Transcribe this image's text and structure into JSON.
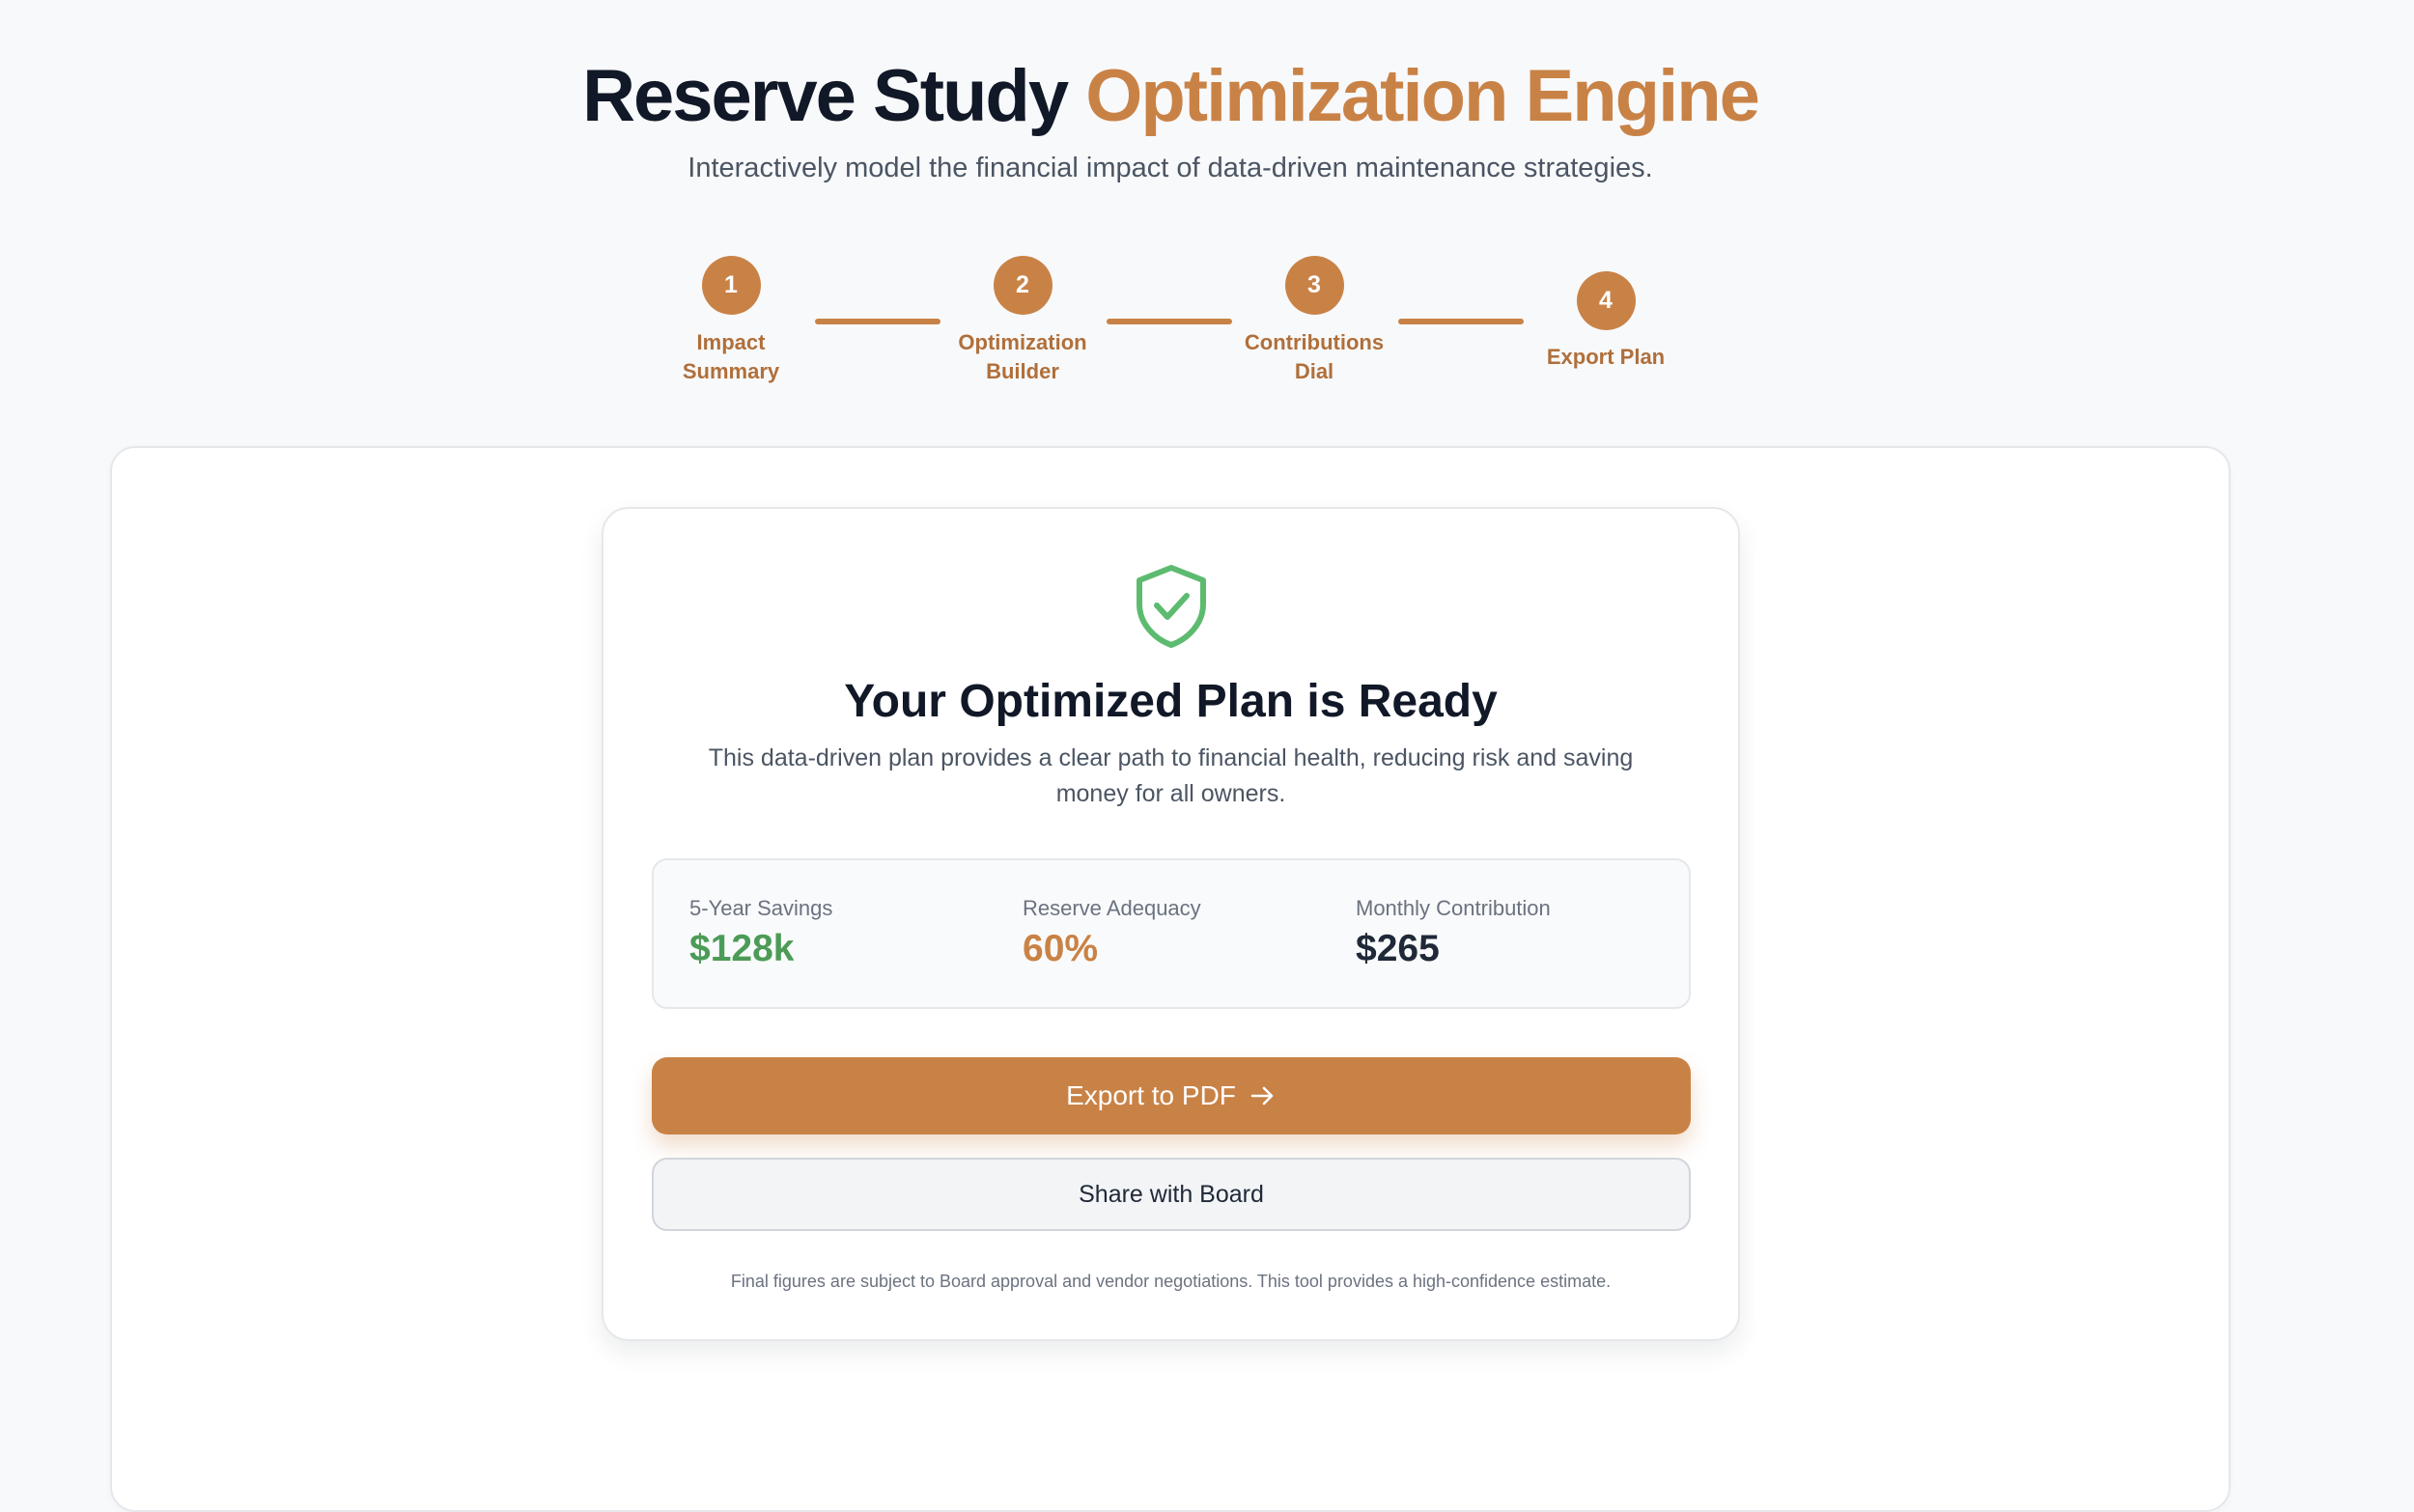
{
  "header": {
    "title_primary": "Reserve Study",
    "title_accent": "Optimization Engine",
    "subtitle": "Interactively model the financial impact of data-driven maintenance strategies."
  },
  "stepper": {
    "steps": [
      {
        "number": "1",
        "label": "Impact Summary"
      },
      {
        "number": "2",
        "label": "Optimization Builder"
      },
      {
        "number": "3",
        "label": "Contributions Dial"
      },
      {
        "number": "4",
        "label": "Export Plan"
      }
    ]
  },
  "card": {
    "icon": "shield-check-icon",
    "title": "Your Optimized Plan is Ready",
    "description": "This data-driven plan provides a clear path to financial health, reducing risk and saving money for all owners.",
    "stats": [
      {
        "label": "5-Year Savings",
        "value": "$128k",
        "color": "#4c9b57"
      },
      {
        "label": "Reserve Adequacy",
        "value": "60%",
        "color": "#c98246"
      },
      {
        "label": "Monthly Contribution",
        "value": "$265",
        "color": "#1f2937"
      }
    ],
    "primary_button": "Export to PDF",
    "secondary_button": "Share with Board",
    "footnote": "Final figures are subject to Board approval and vendor negotiations. This tool provides a high-confidence estimate."
  },
  "colors": {
    "accent": "#c98246",
    "success": "#4c9b57",
    "text_dark": "#111827",
    "background": "#f8f9fb"
  }
}
